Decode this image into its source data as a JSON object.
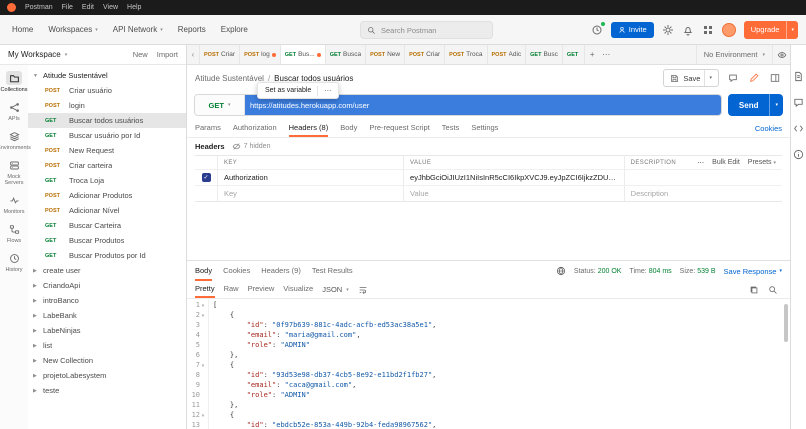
{
  "titlebar": {
    "app": "Postman",
    "menus": [
      "File",
      "Edit",
      "View",
      "Help"
    ]
  },
  "header": {
    "nav": [
      {
        "label": "Home",
        "chevron": false
      },
      {
        "label": "Workspaces",
        "chevron": true
      },
      {
        "label": "API Network",
        "chevron": true
      },
      {
        "label": "Reports",
        "chevron": false
      },
      {
        "label": "Explore",
        "chevron": false
      }
    ],
    "search_placeholder": "Search Postman",
    "invite_label": "Invite",
    "upgrade_label": "Upgrade"
  },
  "sidebar": {
    "workspace_label": "My Workspace",
    "new_label": "New",
    "import_label": "Import",
    "rail": [
      {
        "label": "Collections",
        "icon": "collections",
        "active": true
      },
      {
        "label": "APIs",
        "icon": "apis",
        "active": false
      },
      {
        "label": "Environments",
        "icon": "environments",
        "active": false
      },
      {
        "label": "Mock Servers",
        "icon": "mock",
        "active": false
      },
      {
        "label": "Monitors",
        "icon": "monitors",
        "active": false
      },
      {
        "label": "Flows",
        "icon": "flows",
        "active": false
      },
      {
        "label": "History",
        "icon": "history",
        "active": false
      }
    ],
    "collection": {
      "name": "Atitude Sustentável"
    },
    "requests": [
      {
        "method": "POST",
        "name": "Criar usuário",
        "selected": false
      },
      {
        "method": "POST",
        "name": "login",
        "selected": false
      },
      {
        "method": "GET",
        "name": "Buscar todos usuários",
        "selected": true
      },
      {
        "method": "GET",
        "name": "Buscar usuário por Id",
        "selected": false
      },
      {
        "method": "POST",
        "name": "New Request",
        "selected": false
      },
      {
        "method": "POST",
        "name": "Criar carteira",
        "selected": false
      },
      {
        "method": "GET",
        "name": "Troca Loja",
        "selected": false
      },
      {
        "method": "POST",
        "name": "Adicionar Produtos",
        "selected": false
      },
      {
        "method": "POST",
        "name": "Adicionar Nível",
        "selected": false
      },
      {
        "method": "GET",
        "name": "Buscar Carteira",
        "selected": false
      },
      {
        "method": "GET",
        "name": "Buscar Produtos",
        "selected": false
      },
      {
        "method": "GET",
        "name": "Buscar Produtos por Id",
        "selected": false
      }
    ],
    "collections": [
      "create user",
      "CriandoApi",
      "introBanco",
      "LabeBank",
      "LabeNinjas",
      "list",
      "New Collection",
      "projetoLabesystem",
      "teste"
    ]
  },
  "tabsbar": {
    "tabs": [
      {
        "method": "POST",
        "label": "Criar",
        "dirty": false,
        "active": false
      },
      {
        "method": "POST",
        "label": "log",
        "dirty": true,
        "active": false
      },
      {
        "method": "GET",
        "label": "Bus...",
        "dirty": true,
        "active": true
      },
      {
        "method": "GET",
        "label": "Busca",
        "dirty": false,
        "active": false
      },
      {
        "method": "POST",
        "label": "New",
        "dirty": false,
        "active": false
      },
      {
        "method": "POST",
        "label": "Criar",
        "dirty": false,
        "active": false
      },
      {
        "method": "POST",
        "label": "Troca",
        "dirty": false,
        "active": false
      },
      {
        "method": "POST",
        "label": "Adic",
        "dirty": false,
        "active": false
      },
      {
        "method": "GET",
        "label": "Busc",
        "dirty": false,
        "active": false
      },
      {
        "method": "GET",
        "label": "",
        "dirty": false,
        "active": false
      }
    ],
    "environment": "No Environment"
  },
  "request": {
    "breadcrumb": {
      "collection": "Atitude Sustentável",
      "separator": "/",
      "name": "Buscar todos usuários"
    },
    "popover": {
      "label": "Set as variable",
      "more": "⋯"
    },
    "save_label": "Save",
    "method": "GET",
    "url": "https://atitudes.herokuapp.com/user",
    "send_label": "Send",
    "tabs": [
      {
        "label": "Params",
        "active": false
      },
      {
        "label": "Authorization",
        "active": false
      },
      {
        "label": "Headers (8)",
        "active": true
      },
      {
        "label": "Body",
        "active": false
      },
      {
        "label": "Pre-request Script",
        "active": false
      },
      {
        "label": "Tests",
        "active": false
      },
      {
        "label": "Settings",
        "active": false
      }
    ],
    "cookies_label": "Cookies",
    "headers_section": {
      "title": "Headers",
      "hidden_label": "7 hidden"
    },
    "table": {
      "columns": [
        "KEY",
        "VALUE",
        "DESCRIPTION"
      ],
      "more_label": "⋯",
      "bulk_edit_label": "Bulk Edit",
      "presets_label": "Presets",
      "rows": [
        {
          "checked": true,
          "key": "Authorization",
          "value": "eyJhbGciOiJIUzI1NiIsInR5cCI6IkpXVCJ9.eyJpZCI6IjkzZDUzZTk4LWRiMzct...",
          "description": ""
        }
      ],
      "placeholders": {
        "key": "Key",
        "value": "Value",
        "description": "Description"
      }
    }
  },
  "response": {
    "tabs": [
      {
        "label": "Body",
        "active": true
      },
      {
        "label": "Cookies",
        "active": false
      },
      {
        "label": "Headers (9)",
        "active": false
      },
      {
        "label": "Test Results",
        "active": false
      }
    ],
    "meta": {
      "status_label": "Status:",
      "status": "200 OK",
      "time_label": "Time:",
      "time": "804 ms",
      "size_label": "Size:",
      "size": "539 B"
    },
    "save_response_label": "Save Response",
    "view_tabs": [
      {
        "label": "Pretty",
        "active": true
      },
      {
        "label": "Raw",
        "active": false
      },
      {
        "label": "Preview",
        "active": false
      },
      {
        "label": "Visualize",
        "active": false
      }
    ],
    "format": "JSON",
    "body_lines": [
      "[",
      "    {",
      "        \"id\": \"0f97b639-881c-4adc-acfb-ed53ac38a5e1\",",
      "        \"email\": \"maria@gmail.com\",",
      "        \"role\": \"ADMIN\"",
      "    },",
      "    {",
      "        \"id\": \"93d53e98-db37-4cb5-8e92-e11bd2f1fb27\",",
      "        \"email\": \"caca@gmail.com\",",
      "        \"role\": \"ADMIN\"",
      "    },",
      "    {",
      "        \"id\": \"ebdcb52e-853a-449b-92b4-feda98967562\","
    ]
  }
}
